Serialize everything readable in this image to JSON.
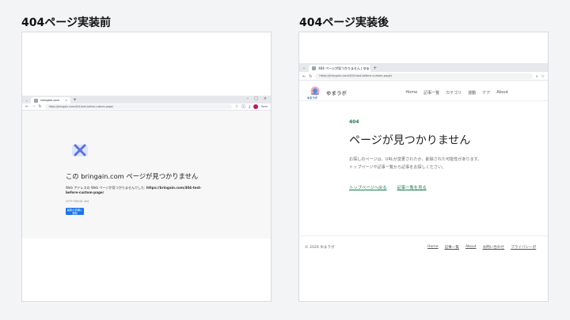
{
  "headings": {
    "before": "404ページ実装前",
    "after": "404ページ実装後"
  },
  "before": {
    "tab_title": "bringain.com",
    "url": "https://bringain.com/404-test-before-custom-page/",
    "profile_label": "Berk",
    "error_title": "この bringain.com ページが見つかりません",
    "error_desc_prefix": "Web アドレスの Web ページが見つかりませんでした: ",
    "error_desc_url": "https://bringain.com/404-test-before-custom-page/",
    "error_code": "HTTP ERROR 404",
    "button_label": "最新の情報に更新"
  },
  "after": {
    "tab_title": "404 ページが見つかりません | ゆまラボ",
    "url": "https://bringain.com/404-test-before-custom-page/",
    "logo_sub": "ゆまラボ",
    "site_name": "ゆまラボ",
    "nav": [
      "Home",
      "記事一覧",
      "カテゴリ",
      "運動",
      "ケア"
    ],
    "nav_about": "About",
    "code": "404",
    "title": "ページが見つかりません",
    "message_line1": "お探しのページは、URLが変更されたか、削除された可能性があります。",
    "message_line2": "トップページや記事一覧から記事をお探しください。",
    "link_top": "トップページへ戻る",
    "link_list": "記事一覧を見る",
    "copyright": "© 2026 ゆまラボ",
    "footer_nav": [
      "Home",
      "記事一覧",
      "About",
      "お問い合わせ",
      "プライバシーポ"
    ]
  },
  "colors": {
    "accent_green": "#1f7a4d",
    "chrome_button": "#1a73e8"
  }
}
